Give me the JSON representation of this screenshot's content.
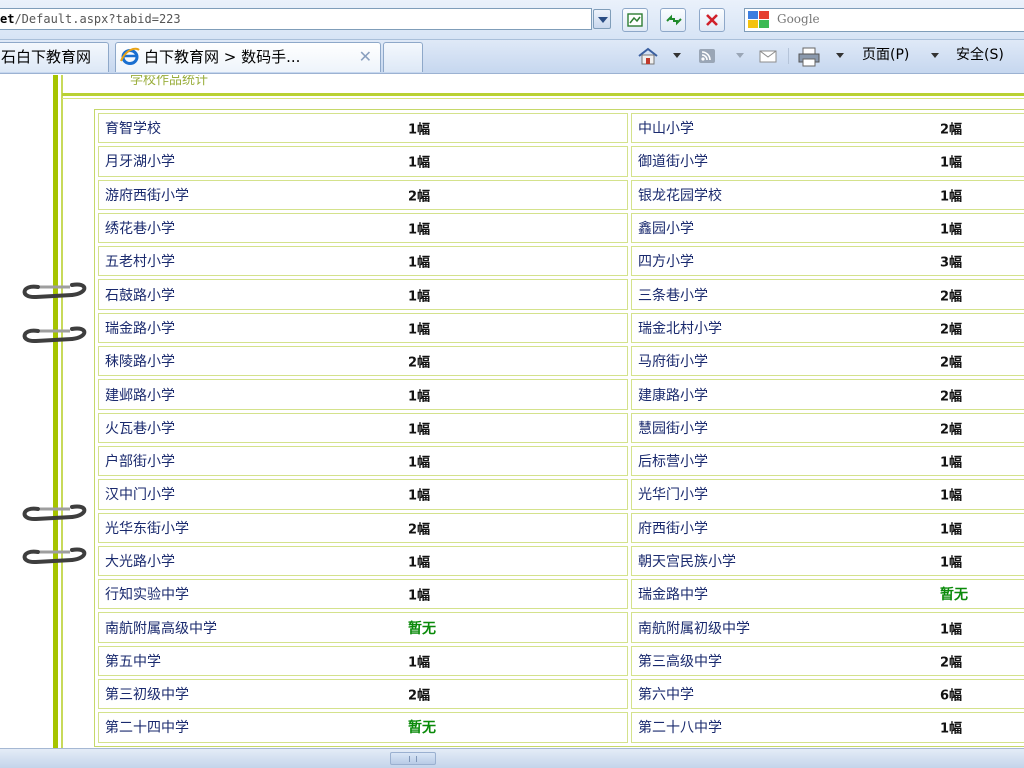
{
  "browser": {
    "address_prefix": "et",
    "address_rest": "/Default.aspx?tabid=223",
    "search_placeholder": "Google",
    "tabs": [
      {
        "label": "石白下教育网"
      },
      {
        "label": "白下教育网 > 数码手..."
      }
    ],
    "commands": {
      "page_label": "页面(P)",
      "safety_label": "安全(S)"
    }
  },
  "section": {
    "title": "学校作品统计"
  },
  "schools": [
    {
      "left_name": "育智学校",
      "left_count": "1幅",
      "right_name": "中山小学",
      "right_count": "2幅"
    },
    {
      "left_name": "月牙湖小学",
      "left_count": "1幅",
      "right_name": "御道街小学",
      "right_count": "1幅"
    },
    {
      "left_name": "游府西街小学",
      "left_count": "2幅",
      "right_name": "银龙花园学校",
      "right_count": "1幅"
    },
    {
      "left_name": "绣花巷小学",
      "left_count": "1幅",
      "right_name": "鑫园小学",
      "right_count": "1幅"
    },
    {
      "left_name": "五老村小学",
      "left_count": "1幅",
      "right_name": "四方小学",
      "right_count": "3幅"
    },
    {
      "left_name": "石鼓路小学",
      "left_count": "1幅",
      "right_name": "三条巷小学",
      "right_count": "2幅"
    },
    {
      "left_name": "瑞金路小学",
      "left_count": "1幅",
      "right_name": "瑞金北村小学",
      "right_count": "2幅"
    },
    {
      "left_name": "秣陵路小学",
      "left_count": "2幅",
      "right_name": "马府街小学",
      "right_count": "2幅"
    },
    {
      "left_name": "建邺路小学",
      "left_count": "1幅",
      "right_name": "建康路小学",
      "right_count": "2幅"
    },
    {
      "left_name": "火瓦巷小学",
      "left_count": "1幅",
      "right_name": "慧园街小学",
      "right_count": "2幅"
    },
    {
      "left_name": "户部街小学",
      "left_count": "1幅",
      "right_name": "后标营小学",
      "right_count": "1幅"
    },
    {
      "left_name": "汉中门小学",
      "left_count": "1幅",
      "right_name": "光华门小学",
      "right_count": "1幅"
    },
    {
      "left_name": "光华东街小学",
      "left_count": "2幅",
      "right_name": "府西街小学",
      "right_count": "1幅"
    },
    {
      "left_name": "大光路小学",
      "left_count": "1幅",
      "right_name": "朝天宫民族小学",
      "right_count": "1幅"
    },
    {
      "left_name": "行知实验中学",
      "left_count": "1幅",
      "right_name": "瑞金路中学",
      "right_count": "暂无"
    },
    {
      "left_name": "南航附属高级中学",
      "left_count": "暂无",
      "right_name": "南航附属初级中学",
      "right_count": "1幅"
    },
    {
      "left_name": "第五中学",
      "left_count": "1幅",
      "right_name": "第三高级中学",
      "right_count": "2幅"
    },
    {
      "left_name": "第三初级中学",
      "left_count": "2幅",
      "right_name": "第六中学",
      "right_count": "6幅"
    },
    {
      "left_name": "第二十四中学",
      "left_count": "暂无",
      "right_name": "第二十八中学",
      "right_count": "1幅"
    }
  ],
  "colors": {
    "accent_green": "#a6c400",
    "none_text": "#0a8a0a",
    "cell_border": "#d4e28c"
  }
}
